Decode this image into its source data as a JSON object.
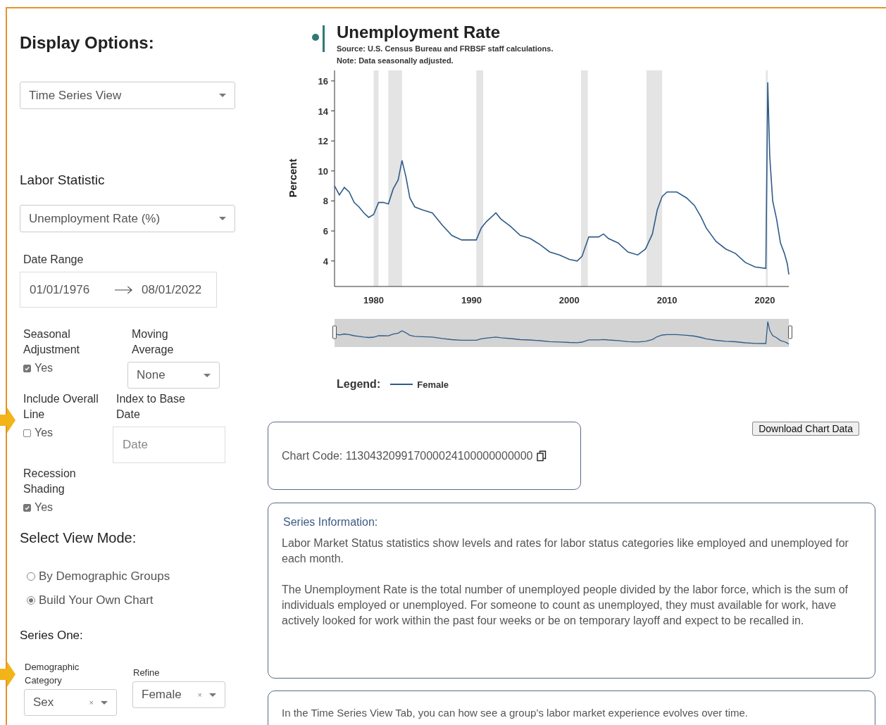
{
  "sidebar": {
    "title": "Display Options:",
    "view_select": {
      "value": "Time Series View"
    },
    "statistic": {
      "label": "Labor Statistic",
      "value": "Unemployment Rate (%)"
    },
    "date_range": {
      "label": "Date Range",
      "start": "01/01/1976",
      "end": "08/01/2022"
    },
    "options": [
      {
        "label": "Seasonal Adjustment",
        "kind": "checkbox",
        "checked": true,
        "option": "Yes"
      },
      {
        "label": "Moving Average",
        "kind": "select",
        "value": "None"
      },
      {
        "label": "Include Overall Line",
        "kind": "checkbox",
        "checked": false,
        "option": "Yes"
      },
      {
        "label": "Index to Base Date",
        "kind": "date",
        "placeholder": "Date"
      },
      {
        "label": "Recession Shading",
        "kind": "checkbox",
        "checked": true,
        "option": "Yes"
      }
    ],
    "view_mode": {
      "title": "Select View Mode:",
      "options": [
        {
          "label": "By Demographic Groups",
          "selected": false
        },
        {
          "label": "Build Your Own Chart",
          "selected": true
        }
      ]
    },
    "series_one": {
      "title": "Series One:",
      "fields": [
        {
          "label": "Demographic Category",
          "value": "Sex",
          "clear": "×"
        },
        {
          "label": "Refine",
          "value": "Female",
          "clear": "×"
        }
      ]
    }
  },
  "chart": {
    "title": "Unemployment Rate",
    "source": "Source: U.S. Census Bureau and FRBSF staff calculations.",
    "note": "Note: Data seasonally adjusted.",
    "legend_label": "Legend:",
    "chart_data": {
      "type": "line",
      "ylabel": "Percent",
      "x": [
        1976,
        1976.5,
        1977,
        1977.5,
        1978,
        1978.5,
        1979,
        1979.5,
        1980,
        1980.5,
        1981,
        1981.5,
        1982,
        1982.5,
        1982.9,
        1983.3,
        1983.7,
        1984.2,
        1985,
        1986,
        1987,
        1988,
        1989,
        1990,
        1990.5,
        1991,
        1991.5,
        1992.5,
        1993,
        1994,
        1995,
        1996,
        1997,
        1998,
        1999,
        2000,
        2000.8,
        2001.3,
        2002,
        2003,
        2003.5,
        2004,
        2005,
        2006,
        2007,
        2007.8,
        2008.5,
        2009,
        2009.5,
        2010,
        2011,
        2012,
        2012.8,
        2013.5,
        2014,
        2015,
        2016,
        2017,
        2018,
        2019,
        2020.1,
        2020.3,
        2020.5,
        2020.8,
        2021.2,
        2021.6,
        2022,
        2022.3,
        2022.45
      ],
      "series": [
        {
          "name": "Female",
          "color": "#2f5b88",
          "values": [
            9.0,
            8.4,
            8.9,
            8.6,
            7.9,
            7.6,
            7.2,
            6.9,
            7.1,
            7.9,
            7.9,
            7.8,
            8.8,
            9.4,
            10.7,
            9.6,
            8.2,
            7.6,
            7.4,
            7.2,
            6.4,
            5.7,
            5.4,
            5.4,
            5.4,
            6.2,
            6.6,
            7.2,
            6.8,
            6.3,
            5.7,
            5.5,
            5.1,
            4.6,
            4.4,
            4.1,
            4.0,
            4.3,
            5.6,
            5.6,
            5.8,
            5.5,
            5.2,
            4.6,
            4.4,
            4.8,
            5.8,
            7.4,
            8.3,
            8.6,
            8.6,
            8.2,
            7.7,
            6.9,
            6.2,
            5.3,
            4.8,
            4.5,
            3.9,
            3.6,
            3.5,
            15.9,
            11.0,
            8.0,
            6.8,
            5.2,
            4.5,
            3.8,
            3.1
          ]
        }
      ],
      "xlim": [
        1976,
        2022.45
      ],
      "ylim": [
        2.3,
        16.7
      ],
      "xticks": [
        1980,
        1990,
        2000,
        2010,
        2020
      ],
      "yticks": [
        4,
        6,
        8,
        10,
        12,
        14,
        16
      ]
    }
  },
  "chart_code": {
    "text": "Chart Code: 113043209917000024100000000000"
  },
  "download_button": "Download Chart Data",
  "series_info": {
    "title": "Series Information:",
    "paragraphs": [
      "Labor Market Status statistics show levels and rates for labor status categories like employed and unemployed for each month.",
      "The Unemployment Rate is the total number of unemployed people divided by the labor force, which is the sum of individuals employed or unemployed. For someone to count as unemployed, they must available for work, have actively looked for work within the past four weeks or be on temporary layoff and expect to be recalled in."
    ]
  },
  "help": {
    "text": "In the Time Series View Tab, you can how see a group’s labor market experience evolves over time."
  }
}
